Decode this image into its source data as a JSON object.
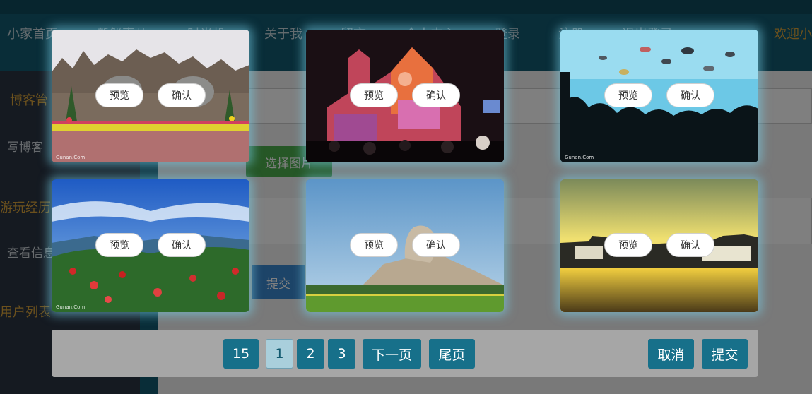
{
  "nav": {
    "items": [
      "小家首页",
      "新鲜事儿",
      "时光机",
      "关于我",
      "留言",
      "个人中心",
      "登录",
      "注册",
      "退出登录"
    ],
    "welcome": "欢迎小"
  },
  "sidebar": {
    "section1": "博客管",
    "write": "写博客",
    "section2": "游玩经历",
    "view": "查看信息",
    "section3": "用户列表"
  },
  "content": {
    "choose_image_label": "选择图片",
    "submit_label": "提交"
  },
  "picker": {
    "preview_label": "预览",
    "confirm_label": "确认",
    "watermark": "Gunan.Com",
    "images": [
      {
        "icon": "elephant-park-photo"
      },
      {
        "icon": "church-light-show-photo"
      },
      {
        "icon": "aquarium-crowd-photo"
      },
      {
        "icon": "mountain-flowers-photo"
      },
      {
        "icon": "mao-statue-photo"
      },
      {
        "icon": "sunset-river-photo"
      }
    ],
    "pager": {
      "total": "15",
      "pages": [
        "1",
        "2",
        "3"
      ],
      "current_page": "1",
      "next_label": "下一页",
      "last_label": "尾页"
    },
    "cancel_label": "取消",
    "submit_label": "提交"
  },
  "colors": {
    "nav_bg": "#135a70",
    "accent_gold": "#d8a23a",
    "button_teal": "#17708a",
    "active_page": "#a9cfdc"
  }
}
